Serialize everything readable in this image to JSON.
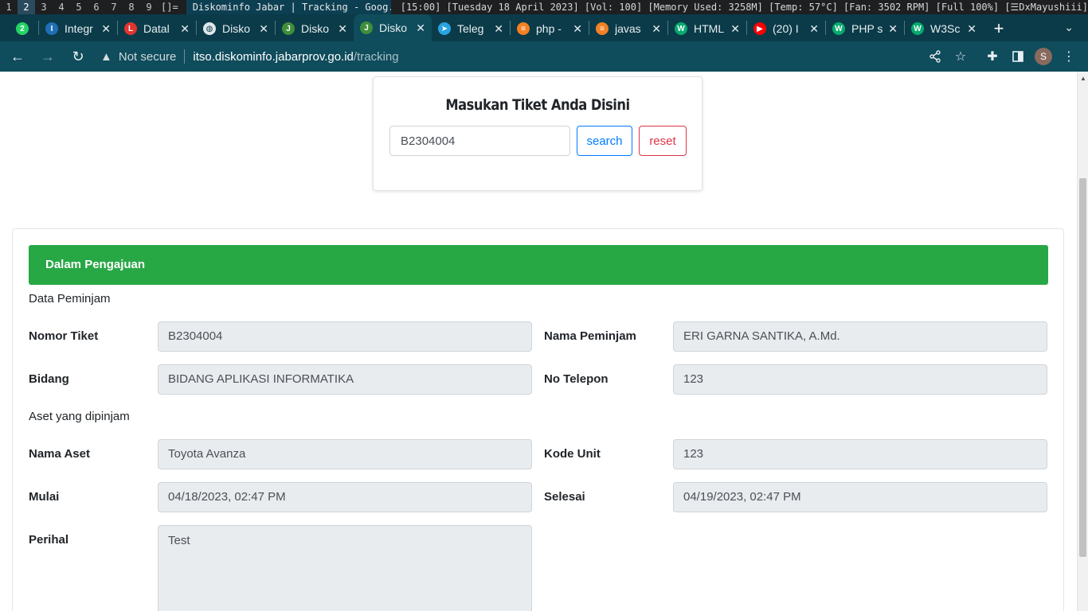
{
  "wm": {
    "workspaces": [
      "1",
      "2",
      "3",
      "4",
      "5",
      "6",
      "7",
      "8",
      "9"
    ],
    "active_workspace": "2",
    "layout": "[]=",
    "window_title": "Diskominfo Jabar | Tracking - Goog...",
    "status": "[15:00] [Tuesday 18 April 2023] [Vol: 100] [Memory Used: 3258M] [Temp: 57°C] [Fan: 3502 RPM] [Full 100%] [☰DxMayushiii]"
  },
  "browser": {
    "tabs": [
      {
        "label": "",
        "icon": "whatsapp-icon",
        "color": "#25d366",
        "glyph": "2"
      },
      {
        "label": "Integr",
        "icon": "intellij-icon",
        "color": "#1f6fb5",
        "glyph": "I"
      },
      {
        "label": "Datal",
        "icon": "laravel-icon",
        "color": "#e3342f",
        "glyph": "L"
      },
      {
        "label": "Disko",
        "icon": "globe-icon",
        "color": "#dfe7ea",
        "glyph": "◍"
      },
      {
        "label": "Disko",
        "icon": "jabar-logo-icon",
        "color": "#3f8f3a",
        "glyph": "J"
      },
      {
        "label": "Disko",
        "icon": "jabar-logo-icon",
        "color": "#3f8f3a",
        "glyph": "J"
      },
      {
        "label": "Teleg",
        "icon": "telegram-icon",
        "color": "#2aa3e0",
        "glyph": "➤"
      },
      {
        "label": "php -",
        "icon": "stackoverflow-icon",
        "color": "#f48024",
        "glyph": "≡"
      },
      {
        "label": "javas",
        "icon": "stackoverflow-icon",
        "color": "#f48024",
        "glyph": "≡"
      },
      {
        "label": "HTML",
        "icon": "w3schools-icon",
        "color": "#04aa6d",
        "glyph": "W"
      },
      {
        "label": "(20) I",
        "icon": "youtube-icon",
        "color": "#ff0000",
        "glyph": "▶"
      },
      {
        "label": "PHP s",
        "icon": "w3schools-icon",
        "color": "#04aa6d",
        "glyph": "W"
      },
      {
        "label": "W3Sc",
        "icon": "w3schools-icon",
        "color": "#04aa6d",
        "glyph": "W"
      }
    ],
    "active_tab_index": 5,
    "security_label": "Not secure",
    "url_host": "itso.diskominfo.jabarprov.go.id",
    "url_path": "/tracking",
    "profile_initial": "S"
  },
  "search": {
    "title": "Masukan Tiket Anda Disini",
    "ticket_value": "B2304004",
    "search_label": "search",
    "reset_label": "reset"
  },
  "result": {
    "status": "Dalam Pengajuan",
    "status_color": "#28a745",
    "section_borrower": "Data Peminjam",
    "section_asset": "Aset yang dipinjam",
    "fields": {
      "nomor_tiket": {
        "label": "Nomor Tiket",
        "value": "B2304004"
      },
      "nama_peminjam": {
        "label": "Nama Peminjam",
        "value": "ERI GARNA SANTIKA, A.Md."
      },
      "bidang": {
        "label": "Bidang",
        "value": "BIDANG APLIKASI INFORMATIKA"
      },
      "no_telepon": {
        "label": "No Telepon",
        "value": "123"
      },
      "nama_aset": {
        "label": "Nama Aset",
        "value": "Toyota Avanza"
      },
      "kode_unit": {
        "label": "Kode Unit",
        "value": "123"
      },
      "mulai": {
        "label": "Mulai",
        "value": "04/18/2023, 02:47 PM"
      },
      "selesai": {
        "label": "Selesai",
        "value": "04/19/2023, 02:47 PM"
      },
      "perihal": {
        "label": "Perihal",
        "value": "Test"
      }
    }
  }
}
